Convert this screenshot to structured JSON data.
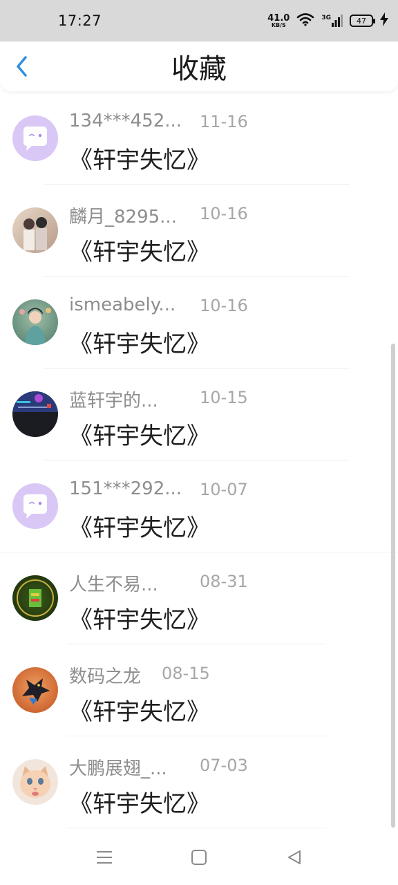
{
  "status_bar": {
    "time": "17:27",
    "net_speed_value": "41.0",
    "net_speed_unit": "KB/S",
    "network_type": "3G",
    "battery": "47"
  },
  "header": {
    "back_icon": "chevron-left-icon",
    "title": "收藏"
  },
  "favorites": [
    {
      "name": "134***452...",
      "date": "11-16",
      "content": "《轩宇失忆》",
      "avatar": "chat-bubble-avatar"
    },
    {
      "name": "麟月_8295...",
      "date": "10-16",
      "content": "《轩宇失忆》",
      "avatar": "anime-couple-avatar"
    },
    {
      "name": "ismeabely...",
      "date": "10-16",
      "content": "《轩宇失忆》",
      "avatar": "portrait-woman-avatar"
    },
    {
      "name": "蓝轩宇的...",
      "date": "10-15",
      "content": "《轩宇失忆》",
      "avatar": "game-scene-avatar"
    },
    {
      "name": "151***292...",
      "date": "10-07",
      "content": "《轩宇失忆》",
      "avatar": "chat-bubble-avatar"
    },
    {
      "name": "人生不易...",
      "date": "08-31",
      "content": "《轩宇失忆》",
      "avatar": "green-emblem-avatar"
    },
    {
      "name": "数码之龙",
      "date": "08-15",
      "content": "《轩宇失忆》",
      "avatar": "dragon-avatar"
    },
    {
      "name": "大鹏展翅_...",
      "date": "07-03",
      "content": "《轩宇失忆》",
      "avatar": "kitten-avatar"
    }
  ],
  "nav_bar": {
    "menu_icon": "menu-icon",
    "home_icon": "home-square-icon",
    "back_icon": "back-triangle-icon"
  },
  "colors": {
    "accent": "#2f8fe0",
    "status_bar_bg": "#d9d9d9",
    "name_text": "#8d8d8d",
    "date_text": "#a6a6a6",
    "placeholder_avatar_bg": "#d9c8f6"
  }
}
